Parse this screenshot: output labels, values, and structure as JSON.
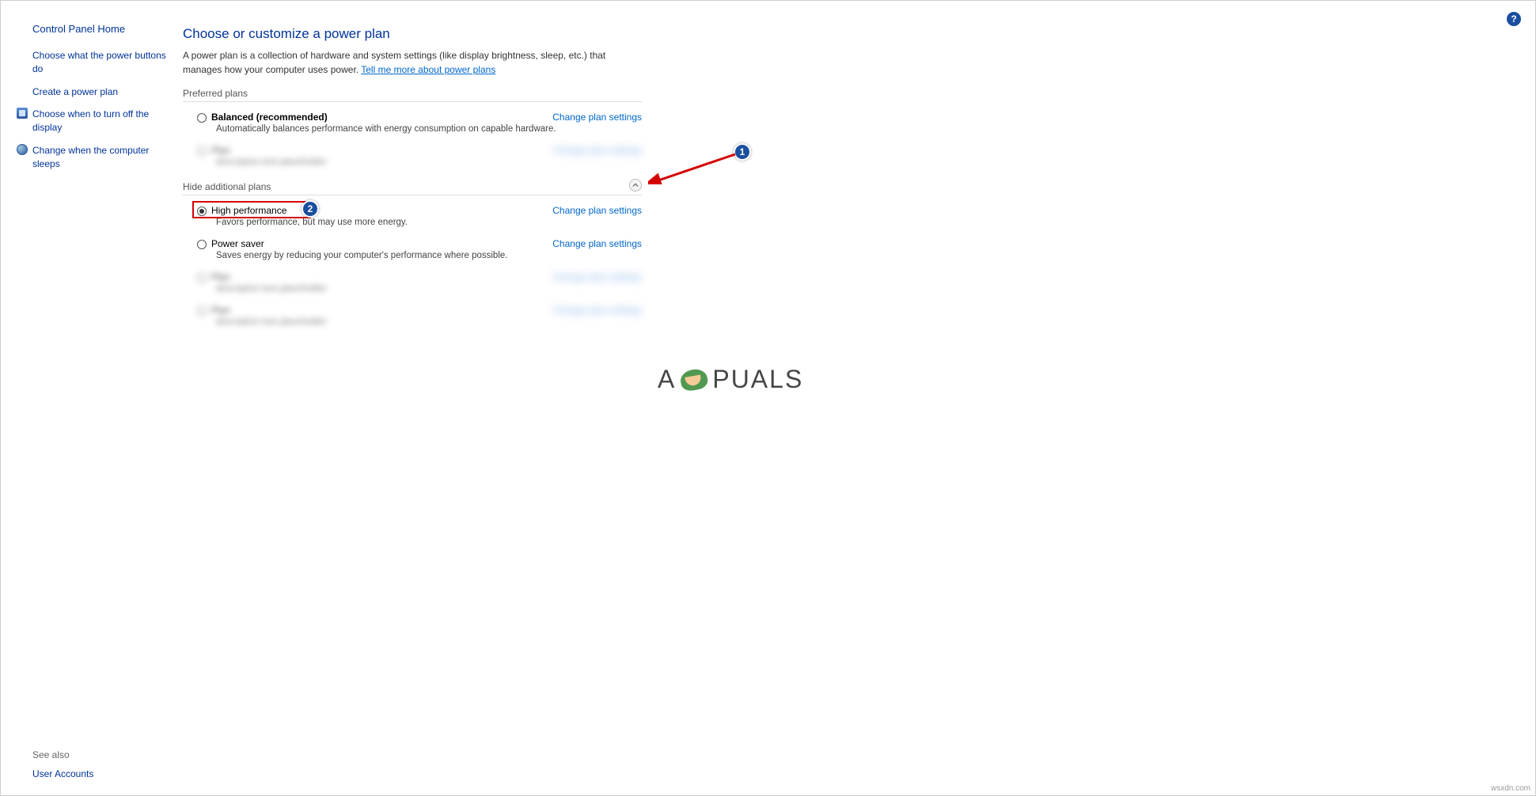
{
  "sidebar": {
    "home": "Control Panel Home",
    "links": [
      {
        "label": "Choose what the power buttons do"
      },
      {
        "label": "Create a power plan"
      },
      {
        "label": "Choose when to turn off the display"
      },
      {
        "label": "Change when the computer sleeps"
      }
    ],
    "see_also": "See also",
    "user_accounts": "User Accounts"
  },
  "main": {
    "title": "Choose or customize a power plan",
    "description_a": "A power plan is a collection of hardware and system settings (like display brightness, sleep, etc.) that manages how your computer uses power. ",
    "description_link": "Tell me more about power plans",
    "preferred_label": "Preferred plans",
    "hide_label": "Hide additional plans",
    "change_link": "Change plan settings",
    "plans_preferred": [
      {
        "name": "Balanced (recommended)",
        "desc": "Automatically balances performance with energy consumption on capable hardware.",
        "selected": false,
        "blurred": false
      },
      {
        "name": "Plan",
        "desc": "description text placeholder",
        "selected": false,
        "blurred": true
      }
    ],
    "plans_additional": [
      {
        "name": "High performance",
        "desc": "Favors performance, but may use more energy.",
        "selected": true,
        "blurred": false,
        "highlighted": true
      },
      {
        "name": "Power saver",
        "desc": "Saves energy by reducing your computer's performance where possible.",
        "selected": false,
        "blurred": false
      },
      {
        "name": "Plan",
        "desc": "description text placeholder",
        "selected": false,
        "blurred": true
      },
      {
        "name": "Plan",
        "desc": "description text placeholder",
        "selected": false,
        "blurred": true
      }
    ]
  },
  "callouts": {
    "one": "1",
    "two": "2"
  },
  "watermark_a": "A",
  "watermark_b": "PUALS",
  "wsx": "wsxdn.com",
  "help": "?"
}
